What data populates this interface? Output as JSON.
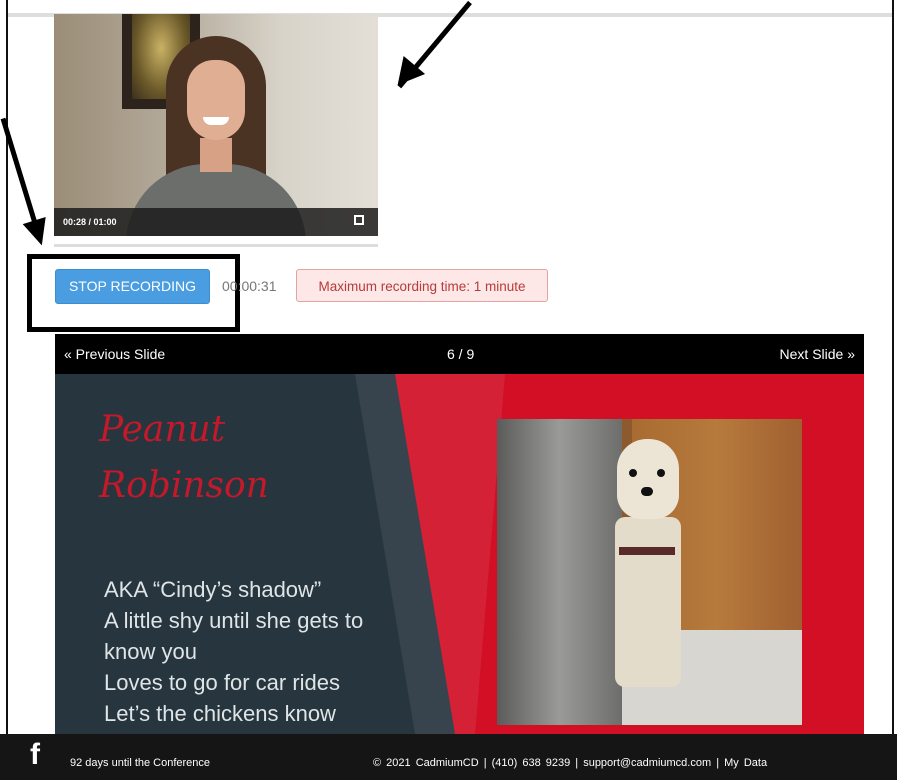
{
  "video": {
    "time": "00:28 / 01:00",
    "fullscreen_icon": "fullscreen-icon"
  },
  "recording": {
    "stop_label": "STOP RECORDING",
    "elapsed": "00:00:31",
    "max_notice": "Maximum recording time: 1 minute"
  },
  "slideshow": {
    "prev_label": "« Previous Slide",
    "counter": "6 / 9",
    "next_label": "Next Slide »"
  },
  "slide": {
    "title_lines": [
      "Peanut",
      "Robinson"
    ],
    "body_lines": [
      "AKA “Cindy’s shadow”",
      "A little shy until she gets to",
      "know you",
      "Loves to go for car rides",
      "Let’s the chickens know"
    ]
  },
  "footer": {
    "social_icon": "facebook-icon",
    "days": "92 days until the Conference",
    "info": "© 2021 CadmiumCD   |   (410) 638 9239   |   support@cadmiumcd.com   |   My Data"
  },
  "colors": {
    "accent_blue": "#4a9de1",
    "alert_red": "#b63b3b",
    "slide_red": "#d20f25",
    "slide_dark": "#26353e"
  }
}
